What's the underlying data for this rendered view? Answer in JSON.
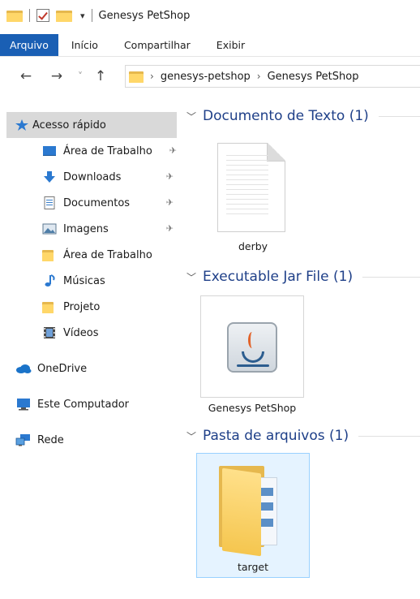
{
  "window": {
    "title": "Genesys PetShop"
  },
  "ribbon": {
    "tabs": [
      "Arquivo",
      "Início",
      "Compartilhar",
      "Exibir"
    ]
  },
  "address": {
    "segments": [
      "genesys-petshop",
      "Genesys PetShop"
    ],
    "separator": "›"
  },
  "nav": {
    "back": "←",
    "forward": "→",
    "recent": "˅",
    "up": "↑"
  },
  "sidebar": {
    "items": [
      {
        "label": "Acesso rápido",
        "icon": "star-icon",
        "selected": true
      },
      {
        "label": "Área de Trabalho",
        "icon": "desktop-icon",
        "pinned": true
      },
      {
        "label": "Downloads",
        "icon": "download-arrow-icon",
        "pinned": true
      },
      {
        "label": "Documentos",
        "icon": "documents-icon",
        "pinned": true
      },
      {
        "label": "Imagens",
        "icon": "pictures-icon",
        "pinned": true
      },
      {
        "label": "Área de Trabalho",
        "icon": "folder-icon"
      },
      {
        "label": "Músicas",
        "icon": "music-note-icon"
      },
      {
        "label": "Projeto",
        "icon": "folder-icon"
      },
      {
        "label": "Vídeos",
        "icon": "film-icon"
      },
      {
        "label": "OneDrive",
        "icon": "cloud-icon"
      },
      {
        "label": "Este Computador",
        "icon": "computer-icon"
      },
      {
        "label": "Rede",
        "icon": "network-icon"
      }
    ]
  },
  "groups": [
    {
      "title": "Documento de Texto (1)",
      "files": [
        {
          "name": "derby",
          "type": "text-document"
        }
      ]
    },
    {
      "title": "Executable Jar File (1)",
      "files": [
        {
          "name": "Genesys PetShop",
          "type": "java-jar"
        }
      ]
    },
    {
      "title": "Pasta de arquivos (1)",
      "files": [
        {
          "name": "target",
          "type": "folder",
          "selected": true
        }
      ]
    }
  ],
  "colors": {
    "accent": "#1a5fb4",
    "group_title": "#1e3f88",
    "selection": "#e5f3ff",
    "selection_border": "#99d1ff",
    "sidebar_selected": "#d9d9d9"
  }
}
